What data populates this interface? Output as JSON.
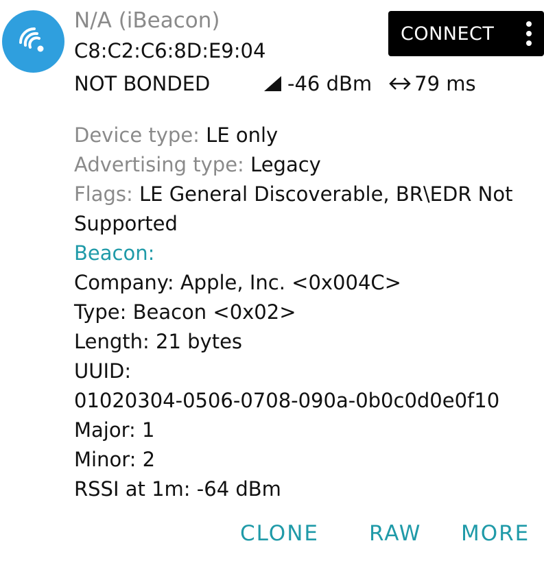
{
  "device": {
    "name": "N/A (iBeacon)",
    "mac": "C8:C2:C6:8D:E9:04",
    "bond_state": "NOT BONDED",
    "rssi": "-46 dBm",
    "interval": "79 ms",
    "icon": "wifi-icon",
    "signal_icon": "signal-icon",
    "interval_icon": "left-right-arrow-icon"
  },
  "connect_button": {
    "label": "CONNECT",
    "menu_icon": "more-vert-icon"
  },
  "details": {
    "device_type": {
      "label": "Device type: ",
      "value": "LE only"
    },
    "advertising_type": {
      "label": "Advertising type: ",
      "value": "Legacy"
    },
    "flags": {
      "label": "Flags: ",
      "value": "LE General Discoverable, BR\\EDR Not Supported"
    },
    "beacon": {
      "title": "Beacon:",
      "company": "Company: Apple, Inc. <0x004C>",
      "type": "Type: Beacon <0x02>",
      "length": "Length: 21 bytes",
      "uuid_label": "UUID:",
      "uuid_value": "01020304-0506-0708-090a-0b0c0d0e0f10",
      "major": "Major: 1",
      "minor": "Minor: 2",
      "rssi_1m": "RSSI at 1m: -64 dBm"
    }
  },
  "actions": {
    "clone": "CLONE",
    "raw": "RAW",
    "more": "MORE"
  },
  "colors": {
    "avatar": "#2f9fde",
    "accent": "#1f9aa8",
    "label_gray": "#8a8a8a",
    "button_bg": "#000000"
  }
}
